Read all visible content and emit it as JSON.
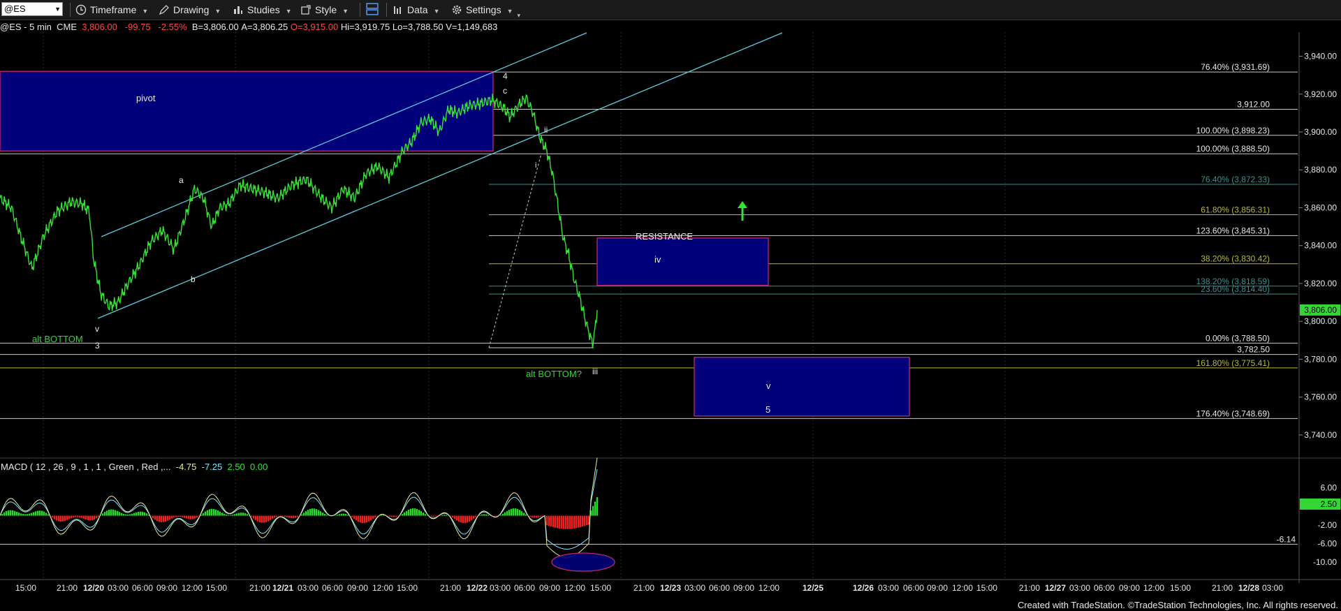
{
  "toolbar": {
    "symbol": "@ES",
    "items": [
      "Timeframe",
      "Drawing",
      "Studies",
      "Style",
      "Data",
      "Settings"
    ]
  },
  "quote": {
    "symbol": "@ES",
    "interval": "5 min",
    "exchange": "CME",
    "last": "3,806.00",
    "change": "-99.75",
    "change_pct": "-2.55%",
    "bid": "B=3,806.00",
    "ask": "A=3,806.25",
    "open": "O=3,915.00",
    "high": "Hi=3,919.75",
    "low": "Lo=3,788.50",
    "volume": "V=1,149,683"
  },
  "colors": {
    "price": "#33e233",
    "channel": "#5bc8dc",
    "box_fill": "#00007a",
    "box_border": "#c0266e",
    "label_green": "#33d633",
    "axis_text": "#e6e6e6",
    "last_badge": "#33d633",
    "macd_line": "#e8e8a0",
    "signal_line": "#7fe7ff",
    "hist_up": "#22dd22",
    "hist_down": "#ee2020"
  },
  "chart_data": {
    "type": "line",
    "title": "",
    "price_axis": {
      "ylim": [
        3730,
        3952
      ],
      "ticks": [
        "3,940.00",
        "3,920.00",
        "3,900.00",
        "3,880.00",
        "3,860.00",
        "3,840.00",
        "3,820.00",
        "3,800.00",
        "3,780.00",
        "3,760.00",
        "3,740.00"
      ]
    },
    "last_price_label": "3,806.00",
    "time_ticks": [
      "15:00",
      "21:00",
      "12/20",
      "03:00",
      "06:00",
      "09:00",
      "12:00",
      "15:00",
      "21:00",
      "12/21",
      "03:00",
      "06:00",
      "09:00",
      "12:00",
      "15:00",
      "21:00",
      "12/22",
      "03:00",
      "06:00",
      "09:00",
      "12:00",
      "15:00",
      "21:00",
      "12/23",
      "03:00",
      "06:00",
      "09:00",
      "12:00",
      "12/25",
      "12/26",
      "03:00",
      "06:00",
      "09:00",
      "12:00",
      "15:00",
      "21:00",
      "12/27",
      "03:00",
      "06:00",
      "09:00",
      "12:00",
      "15:00",
      "21:00",
      "12/28",
      "03:00"
    ],
    "bold_ticks": [
      "12/20",
      "12/21",
      "12/22",
      "12/23",
      "12/25",
      "12/26",
      "12/27",
      "12/28"
    ],
    "price_path": [
      [
        0,
        3865
      ],
      [
        10,
        3860
      ],
      [
        18,
        3845
      ],
      [
        28,
        3828
      ],
      [
        38,
        3845
      ],
      [
        50,
        3858
      ],
      [
        62,
        3863
      ],
      [
        72,
        3862
      ],
      [
        78,
        3858
      ],
      [
        82,
        3832
      ],
      [
        88,
        3815
      ],
      [
        95,
        3808
      ],
      [
        103,
        3810
      ],
      [
        112,
        3820
      ],
      [
        122,
        3830
      ],
      [
        132,
        3842
      ],
      [
        142,
        3848
      ],
      [
        152,
        3838
      ],
      [
        162,
        3855
      ],
      [
        170,
        3870
      ],
      [
        178,
        3865
      ],
      [
        185,
        3850
      ],
      [
        192,
        3860
      ],
      [
        200,
        3862
      ],
      [
        210,
        3872
      ],
      [
        220,
        3870
      ],
      [
        232,
        3868
      ],
      [
        243,
        3865
      ],
      [
        255,
        3872
      ],
      [
        268,
        3875
      ],
      [
        280,
        3866
      ],
      [
        290,
        3860
      ],
      [
        300,
        3870
      ],
      [
        310,
        3865
      ],
      [
        320,
        3878
      ],
      [
        330,
        3882
      ],
      [
        340,
        3876
      ],
      [
        352,
        3890
      ],
      [
        360,
        3895
      ],
      [
        368,
        3905
      ],
      [
        376,
        3907
      ],
      [
        384,
        3900
      ],
      [
        392,
        3912
      ],
      [
        400,
        3910
      ],
      [
        410,
        3914
      ],
      [
        420,
        3915
      ],
      [
        430,
        3917
      ],
      [
        440,
        3913
      ],
      [
        446,
        3908
      ],
      [
        453,
        3914
      ],
      [
        460,
        3918
      ],
      [
        466,
        3910
      ],
      [
        472,
        3897
      ],
      [
        478,
        3890
      ],
      [
        483,
        3878
      ],
      [
        488,
        3860
      ],
      [
        492,
        3845
      ],
      [
        497,
        3835
      ],
      [
        502,
        3822
      ],
      [
        507,
        3812
      ],
      [
        512,
        3800
      ],
      [
        516,
        3792
      ],
      [
        518,
        3788
      ],
      [
        520,
        3795
      ],
      [
        522,
        3806
      ]
    ],
    "price_x_range": [
      0,
      522
    ],
    "price_series_note": "",
    "horizontal_levels": [
      {
        "price": 3931.69,
        "label": "76.40% (3,931.69)",
        "color": "#c8c8c8"
      },
      {
        "price": 3912.0,
        "label": "3,912.00",
        "color": "#c8c8c8"
      },
      {
        "price": 3898.23,
        "label": "100.00% (3,898.23)",
        "color": "#c8c8c8"
      },
      {
        "price": 3888.5,
        "label": "100.00% (3,888.50)",
        "color": "#c8c8c8"
      },
      {
        "price": 3872.33,
        "label": "76.40% (3,872.33)",
        "color": "#3a8f8f"
      },
      {
        "price": 3856.31,
        "label": "61.80% (3,856.31)",
        "color": "#b8b83a"
      },
      {
        "price": 3845.31,
        "label": "123.60% (3,845.31)",
        "color": "#c8c8c8"
      },
      {
        "price": 3830.42,
        "label": "38.20% (3,830.42)",
        "color": "#b8b83a"
      },
      {
        "price": 3818.59,
        "label": "138.20% (3,818.59)",
        "color": "#3a8f8f"
      },
      {
        "price": 3814.4,
        "label": "23.60% (3,814.40)",
        "color": "#3a8f8f"
      },
      {
        "price": 3788.5,
        "label": "0.00% (3,788.50)",
        "color": "#c8c8c8"
      },
      {
        "price": 3782.5,
        "label": "3,782.50",
        "color": "#c8c8c8"
      },
      {
        "price": 3775.41,
        "label": "161.80% (3,775.41)",
        "color": "#b8b83a"
      },
      {
        "price": 3748.69,
        "label": "176.40% (3,748.69)",
        "color": "#c8c8c8"
      }
    ],
    "boxes": [
      {
        "name": "pivot-box",
        "label": "pivot",
        "price_top": 3932,
        "price_bottom": 3890
      },
      {
        "name": "resistance-box",
        "label": "iv",
        "price_top": 3844,
        "price_bottom": 3819
      },
      {
        "name": "target-box",
        "label": "v",
        "sublabel": "5",
        "price_top": 3781,
        "price_bottom": 3750
      }
    ],
    "annotations": [
      "pivot",
      "4",
      "c",
      "ii",
      "a",
      "b",
      "v",
      "3",
      "alt BOTTOM",
      "RESISTANCE",
      "iv",
      "alt BOTTOM?",
      "iii",
      "v",
      "5",
      "i"
    ],
    "macd": {
      "legend_label": "MACD ( 12 , 26 , 9 , 1 , 1 , Green , Red ,...",
      "values": [
        "-4.75",
        "-7.25",
        "2.50",
        "0.00"
      ],
      "ticks": [
        "6.00",
        "-2.00",
        "-6.00",
        "-10.00"
      ],
      "badge": "2.50",
      "level_label": "-6.14",
      "ylim": [
        -13,
        10
      ]
    }
  },
  "footer": "Created with TradeStation. ©TradeStation Technologies, Inc. All rights reserved."
}
